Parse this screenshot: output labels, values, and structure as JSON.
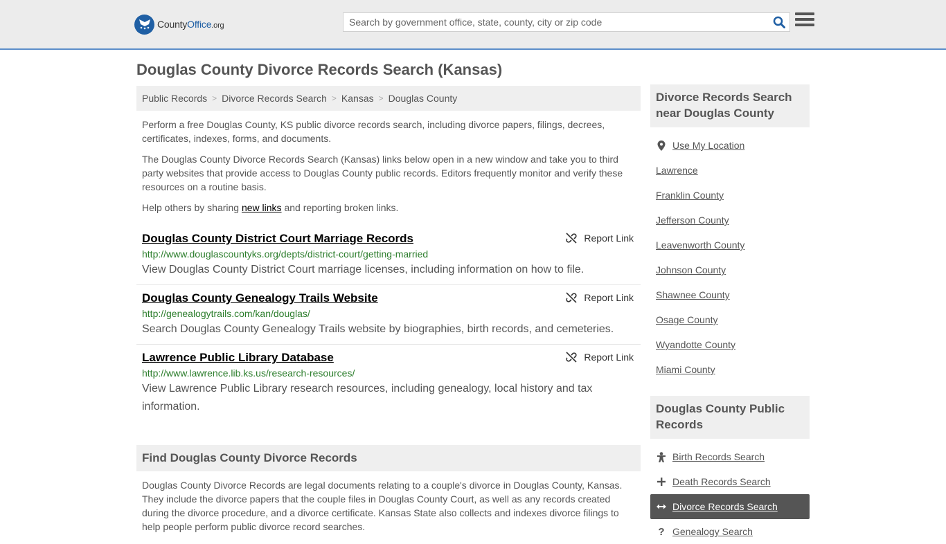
{
  "header": {
    "logo_county": "County",
    "logo_office": "Office",
    "logo_org": ".org",
    "search_placeholder": "Search by government office, state, county, city or zip code"
  },
  "page_title": "Douglas County Divorce Records Search (Kansas)",
  "breadcrumb": [
    "Public Records",
    "Divorce Records Search",
    "Kansas",
    "Douglas County"
  ],
  "intro": {
    "p1": "Perform a free Douglas County, KS public divorce records search, including divorce papers, filings, decrees, certificates, indexes, forms, and documents.",
    "p2": "The Douglas County Divorce Records Search (Kansas) links below open in a new window and take you to third party websites that provide access to Douglas County public records. Editors frequently monitor and verify these resources on a routine basis.",
    "p3_before": "Help others by sharing ",
    "p3_link": "new links",
    "p3_after": " and reporting broken links."
  },
  "report_label": "Report Link",
  "links": [
    {
      "title": "Douglas County District Court Marriage Records",
      "url": "http://www.douglascountyks.org/depts/district-court/getting-married",
      "desc": "View Douglas County District Court marriage licenses, including information on how to file."
    },
    {
      "title": "Douglas County Genealogy Trails Website",
      "url": "http://genealogytrails.com/kan/douglas/",
      "desc": "Search Douglas County Genealogy Trails website by biographies, birth records, and cemeteries."
    },
    {
      "title": "Lawrence Public Library Database",
      "url": "http://www.lawrence.lib.ks.us/research-resources/",
      "desc": "View Lawrence Public Library research resources, including genealogy, local history and tax information."
    }
  ],
  "find_section": {
    "title": "Find Douglas County Divorce Records",
    "body": "Douglas County Divorce Records are legal documents relating to a couple's divorce in Douglas County, Kansas. They include the divorce papers that the couple files in Douglas County Court, as well as any records created during the divorce procedure, and a divorce certificate. Kansas State also collects and indexes divorce filings to help people perform public divorce record searches."
  },
  "sidebar": {
    "nearby_title": "Divorce Records Search near Douglas County",
    "use_location": "Use My Location",
    "nearby": [
      "Lawrence",
      "Franklin County",
      "Jefferson County",
      "Leavenworth County",
      "Johnson County",
      "Shawnee County",
      "Osage County",
      "Wyandotte County",
      "Miami County"
    ],
    "public_title": "Douglas County Public Records",
    "public_records": [
      {
        "label": "Birth Records Search",
        "icon": "baby-icon"
      },
      {
        "label": "Death Records Search",
        "icon": "cross-icon"
      },
      {
        "label": "Divorce Records Search",
        "icon": "arrows-icon",
        "active": true
      },
      {
        "label": "Genealogy Search",
        "icon": "question-icon"
      }
    ]
  }
}
